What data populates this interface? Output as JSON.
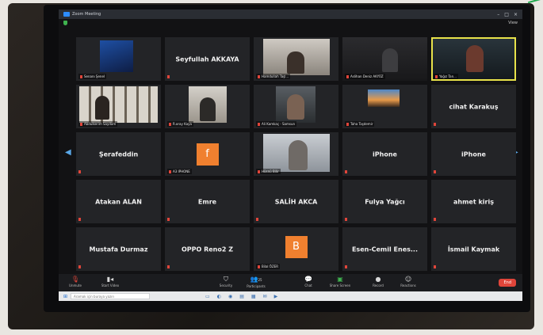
{
  "window": {
    "title": "Zoom Meeting"
  },
  "topbar": {
    "view_label": "View"
  },
  "participants": [
    {
      "id": 1,
      "display": "video",
      "name": "Senanı Şenel"
    },
    {
      "id": 2,
      "display": "name",
      "name": "Seyfullah AKKAYA"
    },
    {
      "id": 3,
      "display": "video",
      "name": "Hamdullah Taşl..."
    },
    {
      "id": 4,
      "display": "video",
      "name": "Aslihan Deniz AKYÜZ"
    },
    {
      "id": 5,
      "display": "video",
      "name": "Yağız Tan...",
      "active": true
    },
    {
      "id": 6,
      "display": "video",
      "name": "Abdulkerim Saydam"
    },
    {
      "id": 7,
      "display": "video",
      "name": "R.oray Kaya"
    },
    {
      "id": 8,
      "display": "video",
      "name": "Ali Kamkaç - Samsun"
    },
    {
      "id": 9,
      "display": "video",
      "name": "Taha Taşdemir"
    },
    {
      "id": 10,
      "display": "name",
      "name": "cihat Karakuş"
    },
    {
      "id": 11,
      "display": "name",
      "name": "Şerafeddin"
    },
    {
      "id": 12,
      "display": "avatar",
      "name": "A3 IPHONE",
      "initial": "f"
    },
    {
      "id": 13,
      "display": "video",
      "name": "Hüsnü Bilir"
    },
    {
      "id": 14,
      "display": "name",
      "name": "iPhone"
    },
    {
      "id": 15,
      "display": "name",
      "name": "iPhone"
    },
    {
      "id": 16,
      "display": "name",
      "name": "Atakan ALAN"
    },
    {
      "id": 17,
      "display": "name",
      "name": "Emre"
    },
    {
      "id": 18,
      "display": "name",
      "name": "SALİH AKCA"
    },
    {
      "id": 19,
      "display": "name",
      "name": "Fulya Yağcı"
    },
    {
      "id": 20,
      "display": "name",
      "name": "ahmet kiriş"
    },
    {
      "id": 21,
      "display": "name",
      "name": "Mustafa Durmaz"
    },
    {
      "id": 22,
      "display": "name",
      "name": "OPPO Reno2 Z"
    },
    {
      "id": 23,
      "display": "avatar",
      "name": "Bilal ÖZER",
      "initial": "B"
    },
    {
      "id": 24,
      "display": "name",
      "name": "Esen-Cemil Enes..."
    },
    {
      "id": 25,
      "display": "name",
      "name": "İsmail Kaymak"
    }
  ],
  "toolbar": {
    "unmute": "Unmute",
    "start_video": "Start Video",
    "security": "Security",
    "participants": "Participants",
    "participants_count": "25",
    "chat": "Chat",
    "share_screen": "Share Screen",
    "record": "Record",
    "reactions": "Reactions",
    "end": "End"
  },
  "taskbar": {
    "search_placeholder": "Aramak için buraya yazın"
  },
  "colors": {
    "accent_blue": "#2d8cff",
    "mute_red": "#e0453a",
    "share_green": "#3fb34f",
    "active_speaker": "#e8e24a",
    "avatar_orange": "#f0802f"
  }
}
